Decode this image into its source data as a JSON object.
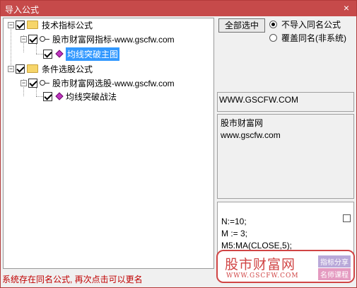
{
  "window": {
    "title": "导入公式",
    "close_glyph": "×"
  },
  "tree": {
    "nodes": [
      {
        "label": "技术指标公式"
      },
      {
        "label": "股市财富网指标-www.gscfw.com"
      },
      {
        "label": "均线突破主图"
      },
      {
        "label": "条件选股公式"
      },
      {
        "label": "股市财富网选股-www.gscfw.com"
      },
      {
        "label": "均线突破战法"
      }
    ]
  },
  "controls": {
    "select_all_label": "全部选中",
    "radio_no_import": "不导入同名公式",
    "radio_overwrite": "覆盖同名(非系统)"
  },
  "info": {
    "url_box": "WWW.GSCFW.COM",
    "desc_line1": "股市财富网",
    "desc_line2": "www.gscfw.com",
    "code_line1": "N:=10;",
    "code_line2": "M := 3;",
    "code_line3": "M5:MA(CLOSE,5);"
  },
  "status": "系统存在同名公式, 再次点击可以更名",
  "watermark": {
    "title": "股市财富网",
    "url": "WWW.GSCFW.COM",
    "tag1": "指标分享",
    "tag2": "名师课程"
  },
  "colors": {
    "title_bar": "#c64a4a",
    "selection": "#3399ff",
    "status_text": "#c00000",
    "watermark": "#d04545"
  }
}
